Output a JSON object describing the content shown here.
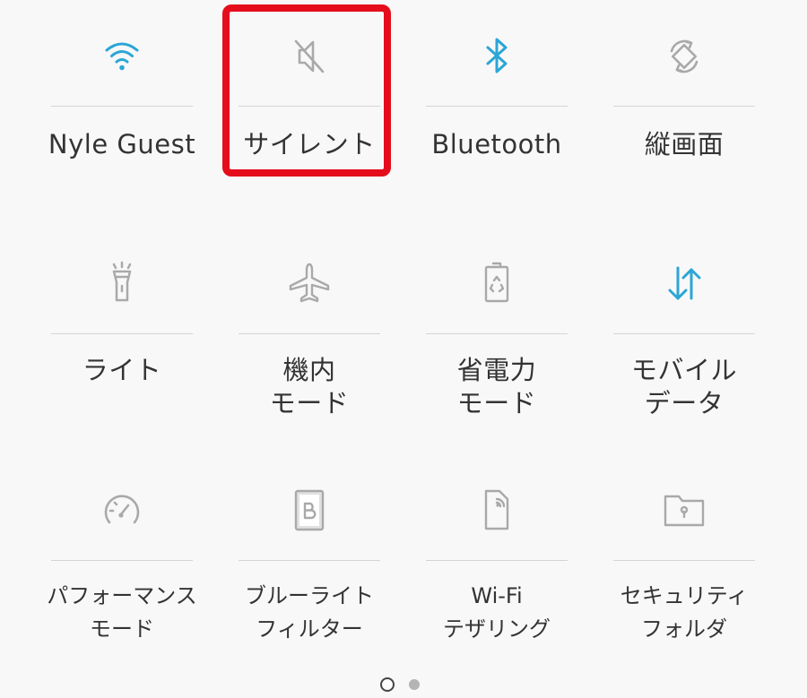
{
  "colors": {
    "active": "#2ba6d6",
    "inactive": "#a9a9a9",
    "highlight": "#e50d1c",
    "text": "#333333"
  },
  "tiles": [
    {
      "label": "Nyle Guest",
      "icon": "wifi-icon",
      "active": true
    },
    {
      "label": "サイレント",
      "icon": "mute-icon",
      "active": false
    },
    {
      "label": "Bluetooth",
      "icon": "bluetooth-icon",
      "active": true
    },
    {
      "label": "縦画面",
      "icon": "rotate-icon",
      "active": false
    },
    {
      "label": "ライト",
      "icon": "flashlight-icon",
      "active": false
    },
    {
      "label": "機内\nモード",
      "icon": "airplane-icon",
      "active": false
    },
    {
      "label": "省電力\nモード",
      "icon": "battery-saver-icon",
      "active": false
    },
    {
      "label": "モバイル\nデータ",
      "icon": "mobile-data-icon",
      "active": true
    },
    {
      "label": "パフォーマンス\nモード",
      "icon": "performance-gauge-icon",
      "active": false
    },
    {
      "label": "ブルーライト\nフィルター",
      "icon": "blue-light-filter-icon",
      "active": false
    },
    {
      "label": "Wi-Fi\nテザリング",
      "icon": "wifi-tethering-icon",
      "active": false
    },
    {
      "label": "セキュリティ\nフォルダ",
      "icon": "secure-folder-icon",
      "active": false
    }
  ],
  "pager": {
    "pages": 2,
    "current": 1
  }
}
